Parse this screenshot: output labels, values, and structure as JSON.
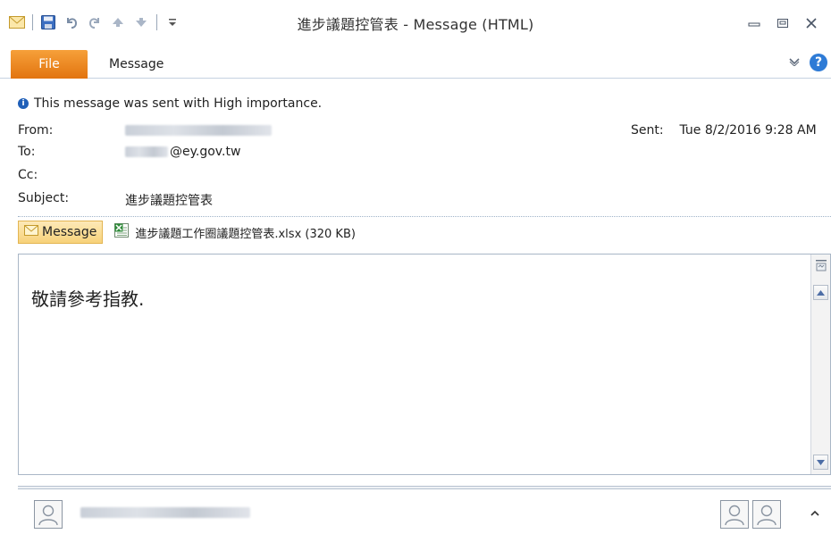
{
  "window": {
    "title": "進步議題控管表 - Message (HTML)"
  },
  "ribbon": {
    "file_tab": "File",
    "message_tab": "Message"
  },
  "header": {
    "importance": "This message was sent with High importance.",
    "from_label": "From:",
    "to_label": "To:",
    "to_value": "@ey.gov.tw",
    "cc_label": "Cc:",
    "subject_label": "Subject:",
    "subject_value": "進步議題控管表",
    "sent_label": "Sent:",
    "sent_value": "Tue 8/2/2016 9:28 AM"
  },
  "attachments": {
    "message_button": "Message",
    "file_name": "進步議題工作圈議題控管表.xlsx (320 KB)"
  },
  "body": {
    "text": "敬請參考指教."
  },
  "icons": {
    "qat": [
      "mail-icon",
      "save-icon",
      "undo-icon",
      "redo-icon",
      "up-arrow-icon",
      "down-arrow-icon",
      "customize-icon"
    ],
    "window": [
      "minimize-icon",
      "restore-icon",
      "close-icon"
    ]
  },
  "colors": {
    "file_tab": "#e2740f",
    "accent_blue": "#2e7bd6",
    "message_btn": "#f7d27a"
  }
}
